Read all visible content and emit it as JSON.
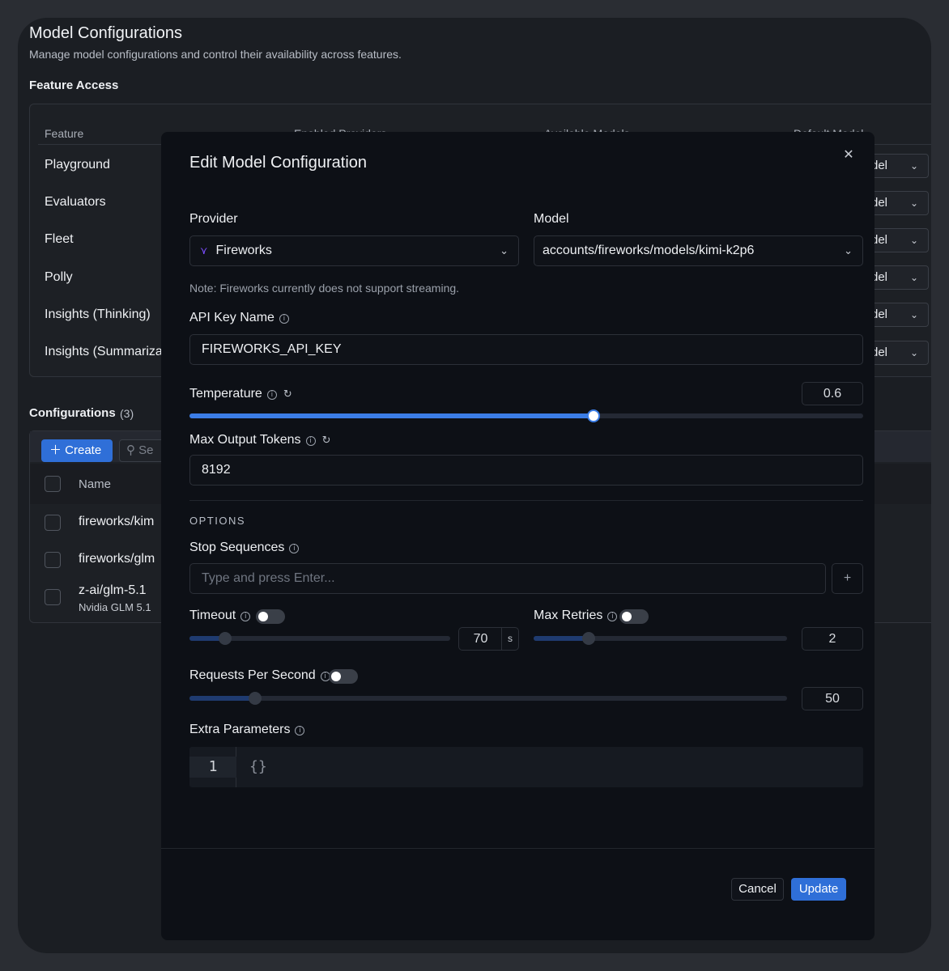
{
  "page": {
    "title": "Model Configurations",
    "subtitle": "Manage model configurations and control their availability across features."
  },
  "feature_access": {
    "title": "Feature Access",
    "columns": [
      "Feature",
      "Enabled Providers",
      "Available Models",
      "Default Model"
    ],
    "rows": [
      {
        "feature": "Playground",
        "default": "del"
      },
      {
        "feature": "Evaluators",
        "default": "del"
      },
      {
        "feature": "Fleet",
        "default": "del"
      },
      {
        "feature": "Polly",
        "default": "del"
      },
      {
        "feature": "Insights (Thinking)",
        "default": "del"
      },
      {
        "feature": "Insights (Summariza",
        "default": "del"
      }
    ]
  },
  "configurations": {
    "title": "Configurations",
    "count": "(3)",
    "create_label": "Create",
    "search_placeholder": "Se",
    "name_column": "Name",
    "rows": [
      {
        "name": "fireworks/kim",
        "sub": ""
      },
      {
        "name": "fireworks/glm",
        "sub": ""
      },
      {
        "name": "z-ai/glm-5.1",
        "sub": "Nvidia GLM 5.1"
      }
    ]
  },
  "modal": {
    "title": "Edit Model Configuration",
    "provider_label": "Provider",
    "provider_value": "Fireworks",
    "model_label": "Model",
    "model_value": "accounts/fireworks/models/kimi-k2p6",
    "note": "Note: Fireworks currently does not support streaming.",
    "api_key_label": "API Key Name",
    "api_key_value": "FIREWORKS_API_KEY",
    "temperature_label": "Temperature",
    "temperature_value": "0.6",
    "temperature_fraction": 0.6,
    "max_tokens_label": "Max Output Tokens",
    "max_tokens_value": "8192",
    "options_label": "OPTIONS",
    "stop_label": "Stop Sequences",
    "stop_placeholder": "Type and press Enter...",
    "add_symbol": "+",
    "timeout_label": "Timeout",
    "timeout_value": "70",
    "timeout_unit": "s",
    "retries_label": "Max Retries",
    "retries_value": "2",
    "rps_label": "Requests Per Second",
    "rps_value": "50",
    "extra_label": "Extra Parameters",
    "line_number": "1",
    "code": "{}",
    "cancel_label": "Cancel",
    "update_label": "Update"
  },
  "colors": {
    "accent": "#2f6fd8",
    "slider_active": "#3b7de6",
    "slider_muted": "#1f3b70"
  }
}
